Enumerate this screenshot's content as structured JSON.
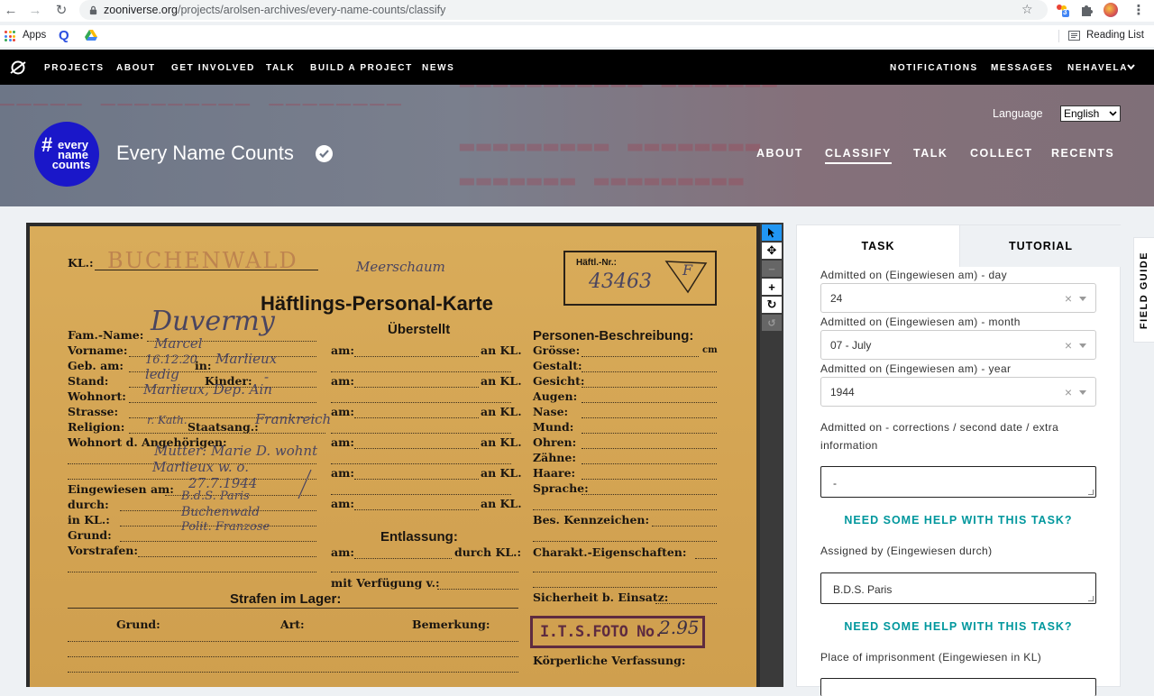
{
  "browser": {
    "url_host": "zooniverse.org",
    "url_path": "/projects/arolsen-archives/every-name-counts/classify",
    "extension_badge": "3",
    "bookmarks": {
      "apps_label": "Apps",
      "q_label": "Q",
      "reading_list_label": "Reading List"
    }
  },
  "zoo_nav": {
    "links": [
      "PROJECTS",
      "ABOUT",
      "GET INVOLVED",
      "TALK",
      "BUILD A PROJECT",
      "NEWS"
    ],
    "right_links": [
      "NOTIFICATIONS",
      "MESSAGES",
      "NEHAVELA"
    ]
  },
  "project": {
    "title": "Every Name Counts",
    "avatar_text": [
      "#",
      "every",
      "name",
      "counts"
    ],
    "language_label": "Language",
    "language_value": "English",
    "links": [
      "ABOUT",
      "CLASSIFY",
      "TALK",
      "COLLECT",
      "RECENTS"
    ],
    "active_link": "CLASSIFY"
  },
  "card": {
    "kl_label": "KL.:",
    "kl_value": "BUCHENWALD",
    "title": "Häftlings-Personal-Karte",
    "haeftl_label": "Häftl.-Nr.:",
    "haeftl_value": "43463",
    "category_mark": "F",
    "hw_meerschaum": "Meerschaum",
    "left_labels": [
      "Fam.-Name:",
      "Vorname:",
      "Geb. am:",
      "Stand:",
      "Wohnort:",
      "Strasse:",
      "Religion:",
      "Wohnort d. Angehörigen:",
      "Eingewiesen am:",
      "durch:",
      "in KL.:",
      "Grund:",
      "Vorstrafen:"
    ],
    "left_values": {
      "fam_name": "Duvermy",
      "vorname": "Marcel",
      "geb_am": "16.12.20",
      "in_label": "in:",
      "geb_in": "Marlieux",
      "stand": "ledig",
      "kinder_label": "Kinder:",
      "kinder": "-",
      "wohnort": "Marlieux, Dep. Ain",
      "religion": "r. Kath.",
      "staatsang_label": "Staatsang.:",
      "staatsang": "Frankreich",
      "angehoerige_1": "Mutter: Marie D. wohnt",
      "angehoerige_2": "Marlieux w. o.",
      "eingewiesen": "27.7.1944",
      "durch": "B.d.S. Paris",
      "in_kl": "Buchenwald",
      "grund": "Polit. Franzose"
    },
    "middle_title": "Überstellt",
    "am_label": "am:",
    "an_kl_label": "an KL.",
    "entlassung_title": "Entlassung:",
    "durch_kl_label": "durch KL.:",
    "verfuegung_label": "mit Verfügung v.:",
    "right_title": "Personen-Beschreibung:",
    "right_labels": [
      "Grösse:",
      "Gestalt:",
      "Gesicht:",
      "Augen:",
      "Nase:",
      "Mund:",
      "Ohren:",
      "Zähne:",
      "Haare:",
      "Sprache:",
      "Bes. Kennzeichen:",
      "Charakt.-Eigenschaften:",
      "Sicherheit b. Einsatz:",
      "Körperliche Verfassung:"
    ],
    "cm_label": "cm",
    "strafen_title": "Strafen im Lager:",
    "strafen_cols": [
      "Grund:",
      "Art:",
      "Bemerkung:"
    ],
    "stamp_text": "I.T.S.FOTO No.",
    "stamp_number": "2.95"
  },
  "panel": {
    "tabs": [
      "TASK",
      "TUTORIAL"
    ],
    "day_label": "Admitted on (Eingewiesen am) - day",
    "day_value": "24",
    "month_label": "Admitted on (Eingewiesen am) - month",
    "month_value": "07 - July",
    "year_label": "Admitted on (Eingewiesen am) - year",
    "year_value": "1944",
    "corrections_label": "Admitted on - corrections / second date / extra information",
    "corrections_value": "-",
    "help_label": "NEED SOME HELP WITH THIS TASK?",
    "assigned_label": "Assigned by (Eingewiesen durch)",
    "assigned_value": "B.D.S. Paris",
    "place_label": "Place of imprisonment (Eingewiesen in KL)",
    "clear_glyph": "×"
  },
  "field_guide_label": "FIELD GUIDE",
  "colors": {
    "accent": "#00979d",
    "avatar_blue": "#1a17c9",
    "card_paper": "#d7a752",
    "tool_active": "#2196f3"
  }
}
